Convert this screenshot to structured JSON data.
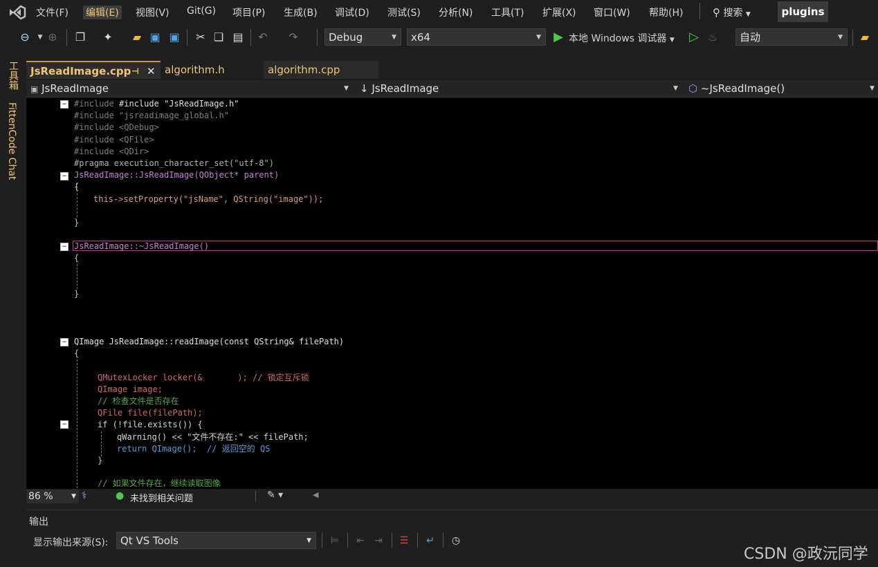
{
  "menu": [
    "文件(F)",
    "编辑(E)",
    "视图(V)",
    "Git(G)",
    "项目(P)",
    "生成(B)",
    "调试(D)",
    "测试(S)",
    "分析(N)",
    "工具(T)",
    "扩展(X)",
    "窗口(W)",
    "帮助(H)"
  ],
  "search_label": "搜索",
  "solution_name": "plugins",
  "toolbar": {
    "config": "Debug",
    "platform": "x64",
    "run_label": "本地 Windows 调试器",
    "mode": "自动"
  },
  "side_panels": [
    "工具箱",
    "FittenCode Chat"
  ],
  "tabs": [
    "JsReadImage.cpp",
    "algorithm.h",
    "algorithm.cpp"
  ],
  "nav": {
    "project": "JsReadImage",
    "class": "JsReadImage",
    "member": "~JsReadImage()"
  },
  "code_lines": [
    "#include \"JsReadImage.h\"",
    "#include \"jsreadimage_global.h\"",
    "#include <QDebug>",
    "#include <QFile>",
    "#include <QDir>",
    "#pragma execution_character_set(\"utf-8\")",
    "JsReadImage::JsReadImage(QObject* parent)",
    "{",
    "this->setProperty(\"jsName\", QString(\"image\"));",
    "}",
    "JsReadImage::~JsReadImage()",
    "{",
    "}",
    "QImage JsReadImage::readImage(const QString& filePath)",
    "{",
    "QMutexLocker locker(&       ); // 锁定互斥锁",
    "QImage image;",
    "// 检查文件是否存在",
    "QFile file(filePath);",
    "if (!file.exists()) {",
    "qWarning() << \"文件不存在:\" << filePath;",
    "return QImage();  // 返回空的 QS",
    "}",
    "// 如果文件存在，继续读取图像"
  ],
  "zoom": "86 %",
  "issues_status": "未找到相关问题",
  "output": {
    "title": "输出",
    "source_label": "显示输出来源(S):",
    "source_value": "Qt VS Tools"
  },
  "watermark": "CSDN @政沅同学",
  "colors": {
    "accent_yellow": "#f0c674",
    "keyword_blue": "#569cd6",
    "type_teal": "#4ec9b0",
    "function_red": "#d16969",
    "comment_green": "#57a64a",
    "current_line": "#c8338c"
  }
}
